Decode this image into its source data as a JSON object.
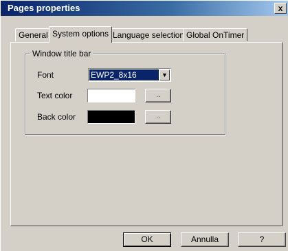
{
  "window": {
    "title": "Pages properties",
    "close_label": "x"
  },
  "tabs": [
    {
      "label": "General"
    },
    {
      "label": "System options",
      "active": true
    },
    {
      "label": "Language selection"
    },
    {
      "label": "Global OnTimer"
    }
  ],
  "group": {
    "title": "Window title bar",
    "font_label": "Font",
    "font_value": "EWP2_8x16",
    "text_color_label": "Text color",
    "text_color": "#ffffff",
    "back_color_label": "Back color",
    "back_color": "#000000",
    "pick_label": ".."
  },
  "buttons": {
    "ok": "OK",
    "cancel": "Annulla",
    "help": "?"
  }
}
